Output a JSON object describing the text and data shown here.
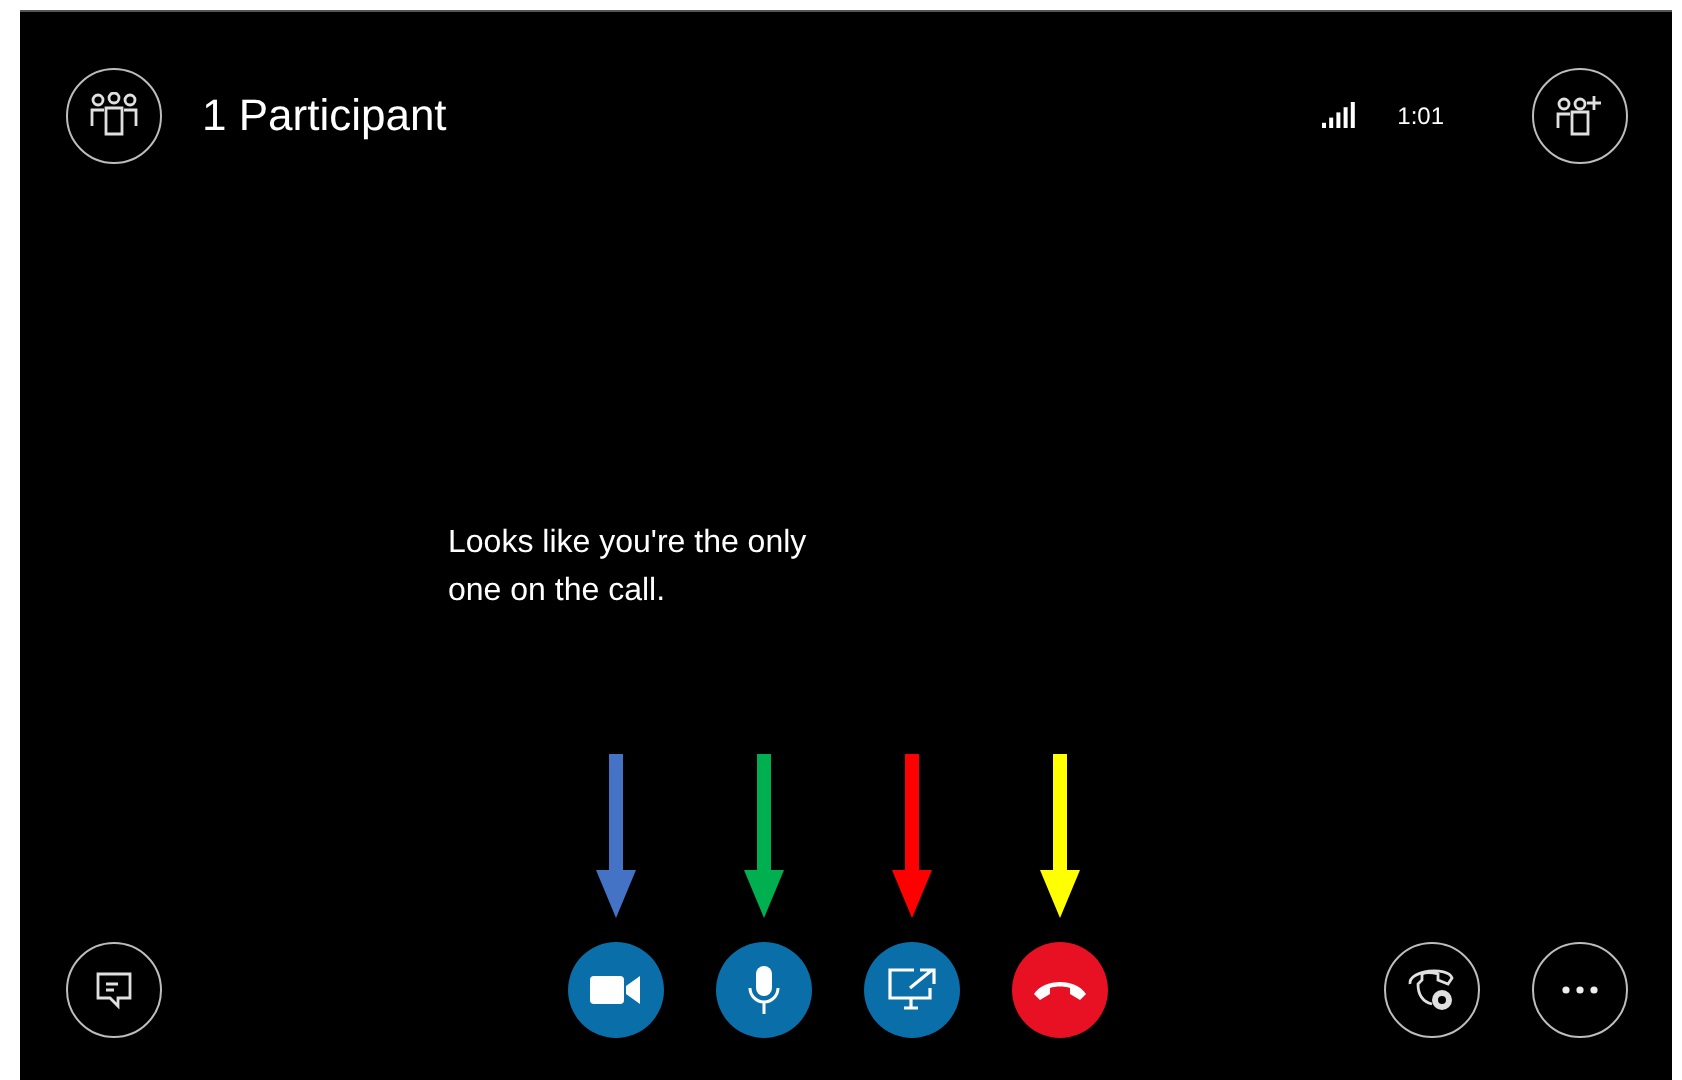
{
  "header": {
    "participants": "1 Participant",
    "call_time": "1:01"
  },
  "message": "Looks like you're the only one on the call.",
  "call_controls": [
    {
      "kind": "video",
      "color": "#4472c4"
    },
    {
      "kind": "mic",
      "color": "#00b050"
    },
    {
      "kind": "share",
      "color": "#ff0000"
    },
    {
      "kind": "hangup",
      "color": "#ffff00"
    }
  ]
}
